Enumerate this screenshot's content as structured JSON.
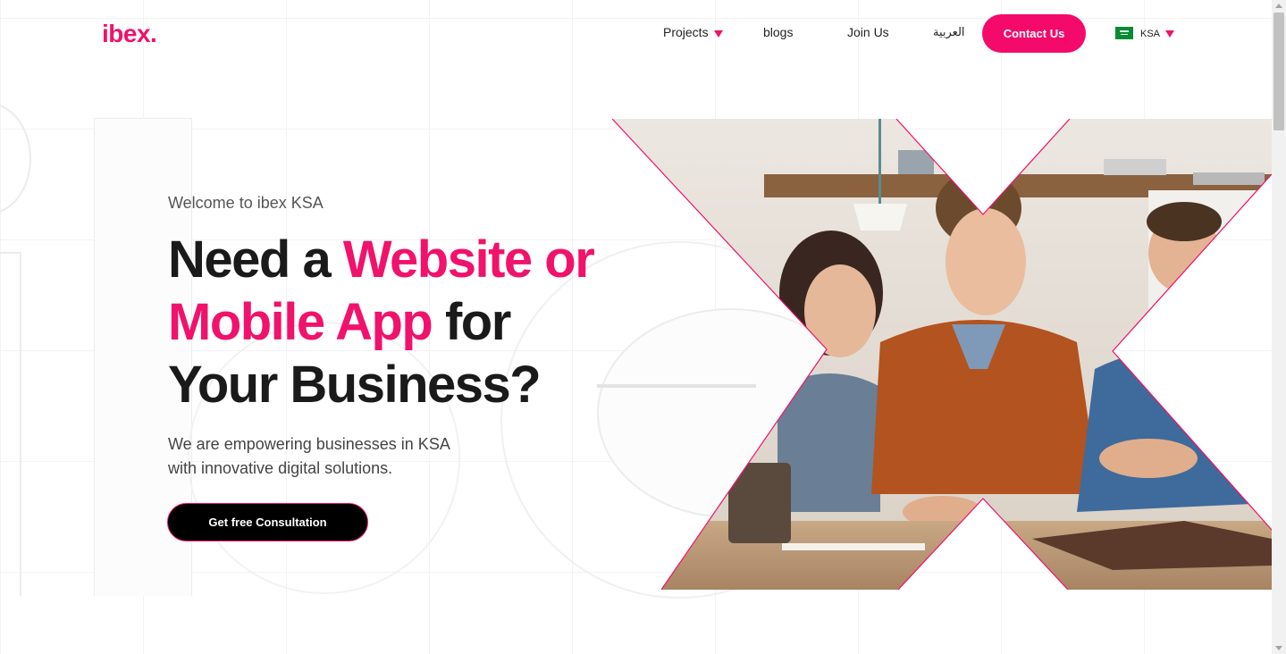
{
  "header": {
    "logo": "ibex.",
    "nav": {
      "projects": "Projects",
      "blogs": "blogs",
      "join_us": "Join Us",
      "arabic": "العربية"
    },
    "contact_label": "Contact Us",
    "region": {
      "label": "KSA",
      "flag_icon": "saudi-flag-icon"
    }
  },
  "hero": {
    "welcome": "Welcome to ibex KSA",
    "headline": {
      "part1": "Need a ",
      "highlight1": "Website or",
      "highlight2": "Mobile App",
      "part2": " for",
      "part3": "Your Business?"
    },
    "subtext_line1": "We are empowering businesses in KSA",
    "subtext_line2": "with innovative digital solutions.",
    "cta_label": "Get free Consultation",
    "image_subject": "team of three people working around a laptop in an office"
  },
  "colors": {
    "brand_pink": "#f0126b",
    "cta_background": "#000000",
    "text_dark": "#1a1a1a"
  },
  "icons": {
    "dropdown": "caret-down-icon",
    "flag": "saudi-flag-icon"
  }
}
